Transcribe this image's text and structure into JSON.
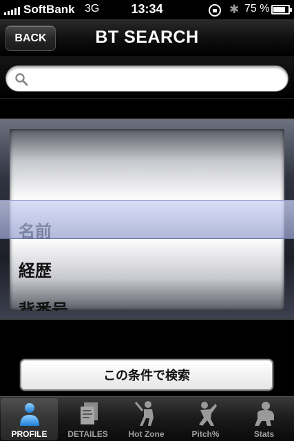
{
  "status_bar": {
    "carrier": "SoftBank",
    "network": "3G",
    "time": "13:34",
    "battery": "75 %"
  },
  "nav_bar": {
    "back_label": "BACK",
    "title": "BT SEARCH"
  },
  "search": {
    "value": "",
    "icon": "search-icon"
  },
  "picker": {
    "options": [
      "名前",
      "経歴",
      "背番号"
    ],
    "selected": "名前"
  },
  "action": {
    "search_button_label": "この条件で検索"
  },
  "tabs": [
    {
      "label": "PROFILE",
      "icon": "profile-icon",
      "active": true
    },
    {
      "label": "DETAILES",
      "icon": "details-icon",
      "active": false
    },
    {
      "label": "Hot Zone",
      "icon": "batter-icon",
      "active": false
    },
    {
      "label": "Pitch%",
      "icon": "pitcher-icon",
      "active": false
    },
    {
      "label": "Stats",
      "icon": "catcher-icon",
      "active": false
    }
  ],
  "colors": {
    "picker_highlight": "#a9b2e0",
    "active_tab_icon": "#3a9ee8"
  }
}
